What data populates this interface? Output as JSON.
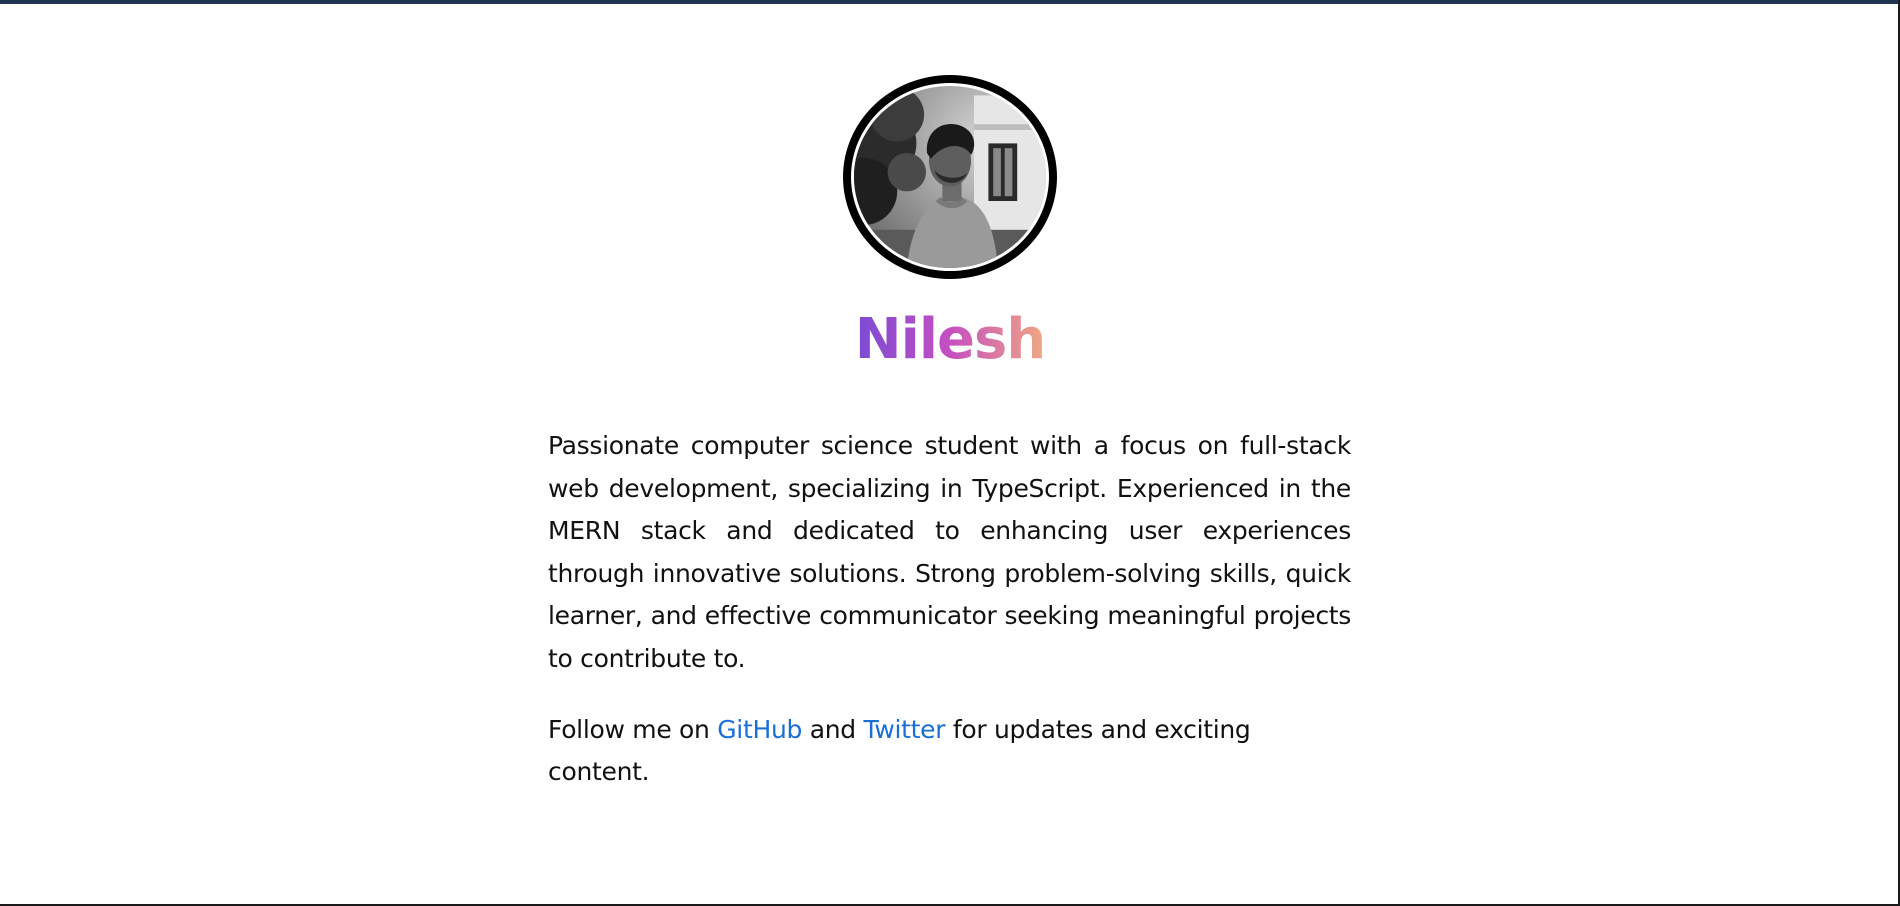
{
  "profile": {
    "name": "Nilesh",
    "avatar_icon": "profile-photo",
    "name_gradient": [
      "#7b4bd6",
      "#c54fc0",
      "#f0a882"
    ]
  },
  "about": {
    "bio": "Passionate computer science student with a focus on full-stack web development, specializing in TypeScript. Experienced in the MERN stack and dedicated to enhancing user experiences through innovative solutions. Strong problem-solving skills, quick learner, and effective communicator seeking meaningful projects to contribute to."
  },
  "follow": {
    "prefix": "Follow me on ",
    "github_label": "GitHub",
    "connector": " and ",
    "twitter_label": "Twitter",
    "suffix": " for updates and exciting content.",
    "link_color": "#1a6fd6"
  },
  "theme": {
    "top_bar_color": "#1f3552"
  }
}
